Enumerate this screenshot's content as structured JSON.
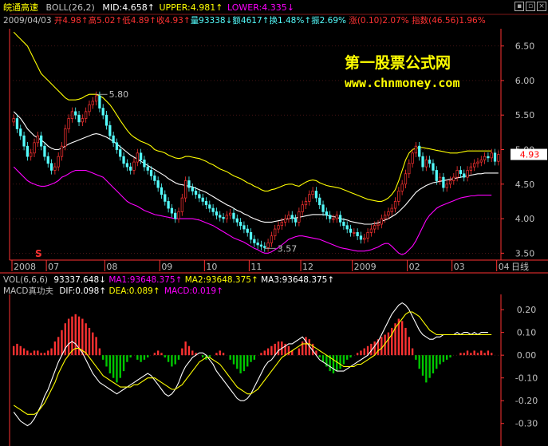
{
  "header": {
    "stock_name": "皖通高速",
    "boll_label": "BOLL(26,2)",
    "mid": "MID:4.658",
    "upper": "UPPER:4.981",
    "lower": "LOWER:4.335",
    "date": "2009/04/03",
    "open": "开4.98",
    "high": "高5.02",
    "low": "低4.89",
    "close": "收4.93",
    "volume": "量93338",
    "amount": "额4617",
    "turnover": "换1.48%",
    "amplitude": "振2.69%",
    "change": "涨(0.10)2.07%",
    "index": "指数(46.56)1.96%"
  },
  "watermark": {
    "title": "第一股票公式网",
    "url": "www.chnmoney.com"
  },
  "vol_bar": {
    "label": "VOL(6,6,6)",
    "value": "93337.648",
    "ma1": "MA1:93648.375",
    "ma2": "MA2:93648.375",
    "ma3": "MA3:93648.375"
  },
  "macd_bar": {
    "label": "MACD真功夫",
    "dif": "DIF:0.098",
    "dea": "DEA:0.089",
    "macd": "MACD:0.019"
  },
  "period_label": "日线",
  "signal_marker": "S",
  "colors": {
    "up": "#ff3232",
    "down": "#54fcfc",
    "upper_band": "#ffff00",
    "mid_band": "#ffffff",
    "lower_band": "#ff00ff",
    "axis": "#ff3232",
    "watermark": "#ffff00",
    "dif": "#ffffff",
    "dea": "#ffff00"
  },
  "chart_data": [
    {
      "type": "candlestick",
      "name": "price",
      "ylim": [
        3.4,
        6.75
      ],
      "y_ticks": [
        "6.50",
        "6.00",
        "5.50",
        "5.00",
        "4.50",
        "4.00",
        "3.50"
      ],
      "y_tick_values": [
        6.5,
        6.0,
        5.5,
        5.0,
        4.5,
        4.0,
        3.5
      ],
      "x_labels": [
        "2008",
        "07",
        "08",
        "09",
        "10",
        "11",
        "12",
        "2009",
        "02",
        "03",
        "04"
      ],
      "x_label_index": [
        0,
        10,
        27,
        43,
        56,
        69,
        84,
        99,
        115,
        128,
        141
      ],
      "annotations": [
        {
          "label": "5.80",
          "index": 24,
          "value": 5.8
        },
        {
          "label": "3.57",
          "index": 73,
          "value": 3.57
        }
      ],
      "last_price": "4.93",
      "last_price_value": 4.93,
      "closes": [
        5.45,
        5.3,
        5.2,
        5.05,
        4.9,
        4.95,
        5.1,
        5.2,
        5.05,
        4.9,
        4.8,
        4.7,
        4.75,
        4.9,
        5.05,
        5.3,
        5.45,
        5.55,
        5.5,
        5.4,
        5.45,
        5.55,
        5.65,
        5.7,
        5.78,
        5.6,
        5.5,
        5.35,
        5.2,
        5.1,
        5.0,
        4.9,
        4.8,
        4.75,
        4.7,
        4.82,
        4.95,
        4.85,
        4.75,
        4.7,
        4.62,
        4.55,
        4.45,
        4.35,
        4.25,
        4.15,
        4.08,
        4.0,
        4.1,
        4.3,
        4.55,
        4.45,
        4.4,
        4.35,
        4.3,
        4.25,
        4.2,
        4.15,
        4.1,
        4.05,
        4.02,
        4.0,
        4.05,
        4.08,
        4.0,
        3.95,
        3.9,
        3.85,
        3.8,
        3.7,
        3.65,
        3.62,
        3.6,
        3.58,
        3.65,
        3.75,
        3.85,
        3.9,
        3.95,
        4.0,
        4.05,
        4.0,
        3.95,
        4.1,
        4.2,
        4.25,
        4.35,
        4.4,
        4.3,
        4.2,
        4.1,
        4.05,
        4.0,
        4.0,
        4.05,
        3.95,
        3.9,
        3.85,
        3.8,
        3.8,
        3.75,
        3.7,
        3.72,
        3.8,
        3.85,
        3.9,
        3.92,
        4.0,
        4.05,
        4.1,
        4.15,
        4.25,
        4.4,
        4.5,
        4.65,
        4.8,
        4.95,
        5.05,
        4.9,
        4.75,
        4.85,
        4.8,
        4.7,
        4.55,
        4.6,
        4.45,
        4.5,
        4.55,
        4.6,
        4.7,
        4.65,
        4.6,
        4.7,
        4.75,
        4.8,
        4.82,
        4.85,
        4.9,
        4.88,
        4.95,
        4.83,
        4.93
      ],
      "upper_band": [
        6.7,
        6.65,
        6.6,
        6.55,
        6.5,
        6.4,
        6.3,
        6.2,
        6.1,
        6.05,
        6.0,
        5.95,
        5.9,
        5.85,
        5.8,
        5.75,
        5.72,
        5.72,
        5.72,
        5.73,
        5.75,
        5.78,
        5.8,
        5.8,
        5.8,
        5.78,
        5.75,
        5.7,
        5.65,
        5.58,
        5.5,
        5.42,
        5.35,
        5.28,
        5.22,
        5.18,
        5.15,
        5.12,
        5.1,
        5.08,
        5.05,
        5.0,
        4.98,
        4.97,
        4.95,
        4.92,
        4.9,
        4.88,
        4.87,
        4.88,
        4.9,
        4.9,
        4.89,
        4.88,
        4.87,
        4.85,
        4.83,
        4.8,
        4.78,
        4.75,
        4.72,
        4.7,
        4.68,
        4.65,
        4.62,
        4.6,
        4.58,
        4.55,
        4.52,
        4.5,
        4.47,
        4.45,
        4.42,
        4.4,
        4.4,
        4.42,
        4.43,
        4.45,
        4.47,
        4.49,
        4.5,
        4.5,
        4.48,
        4.47,
        4.5,
        4.53,
        4.55,
        4.56,
        4.55,
        4.52,
        4.5,
        4.48,
        4.47,
        4.46,
        4.45,
        4.44,
        4.42,
        4.4,
        4.38,
        4.36,
        4.34,
        4.32,
        4.3,
        4.28,
        4.27,
        4.26,
        4.25,
        4.25,
        4.27,
        4.3,
        4.35,
        4.42,
        4.55,
        4.7,
        4.85,
        4.95,
        5.0,
        5.02,
        5.03,
        5.03,
        5.02,
        5.01,
        5.0,
        4.99,
        4.98,
        4.97,
        4.96,
        4.95,
        4.95,
        4.95,
        4.96,
        4.97,
        4.98,
        4.98,
        4.98,
        4.98,
        4.98,
        4.98,
        4.98,
        4.98
      ],
      "mid_band": [
        5.55,
        5.5,
        5.45,
        5.38,
        5.3,
        5.25,
        5.2,
        5.17,
        5.14,
        5.1,
        5.05,
        5.02,
        5.0,
        5.0,
        5.02,
        5.05,
        5.08,
        5.1,
        5.12,
        5.14,
        5.16,
        5.18,
        5.2,
        5.22,
        5.23,
        5.22,
        5.2,
        5.18,
        5.15,
        5.12,
        5.08,
        5.04,
        5.0,
        4.96,
        4.92,
        4.89,
        4.86,
        4.83,
        4.8,
        4.77,
        4.74,
        4.71,
        4.68,
        4.65,
        4.62,
        4.58,
        4.55,
        4.52,
        4.5,
        4.49,
        4.48,
        4.47,
        4.46,
        4.44,
        4.42,
        4.4,
        4.38,
        4.35,
        4.32,
        4.29,
        4.26,
        4.23,
        4.2,
        4.18,
        4.15,
        4.12,
        4.1,
        4.07,
        4.05,
        4.02,
        4.0,
        3.98,
        3.96,
        3.95,
        3.95,
        3.95,
        3.96,
        3.97,
        3.98,
        3.99,
        4.0,
        4.01,
        4.01,
        4.02,
        4.03,
        4.04,
        4.05,
        4.06,
        4.06,
        4.06,
        4.06,
        4.05,
        4.04,
        4.03,
        4.02,
        4.0,
        3.99,
        3.98,
        3.96,
        3.95,
        3.94,
        3.93,
        3.92,
        3.92,
        3.92,
        3.93,
        3.94,
        3.96,
        3.98,
        4.0,
        4.03,
        4.06,
        4.1,
        4.15,
        4.2,
        4.26,
        4.32,
        4.38,
        4.42,
        4.45,
        4.48,
        4.5,
        4.52,
        4.53,
        4.54,
        4.55,
        4.56,
        4.57,
        4.58,
        4.59,
        4.6,
        4.61,
        4.62,
        4.63,
        4.64,
        4.65,
        4.65,
        4.66,
        4.66,
        4.66,
        4.66,
        4.66
      ],
      "lower_band": [
        4.75,
        4.7,
        4.65,
        4.6,
        4.55,
        4.52,
        4.5,
        4.48,
        4.47,
        4.47,
        4.48,
        4.5,
        4.52,
        4.55,
        4.6,
        4.62,
        4.65,
        4.68,
        4.7,
        4.7,
        4.7,
        4.7,
        4.68,
        4.66,
        4.64,
        4.62,
        4.6,
        4.55,
        4.5,
        4.45,
        4.4,
        4.35,
        4.3,
        4.25,
        4.22,
        4.2,
        4.18,
        4.15,
        4.12,
        4.1,
        4.08,
        4.06,
        4.05,
        4.04,
        4.03,
        4.02,
        4.01,
        4.0,
        4.0,
        4.0,
        4.0,
        4.0,
        4.0,
        3.99,
        3.98,
        3.96,
        3.94,
        3.92,
        3.9,
        3.87,
        3.84,
        3.81,
        3.78,
        3.75,
        3.72,
        3.7,
        3.68,
        3.66,
        3.63,
        3.6,
        3.57,
        3.55,
        3.52,
        3.5,
        3.5,
        3.52,
        3.55,
        3.58,
        3.62,
        3.66,
        3.7,
        3.72,
        3.74,
        3.75,
        3.75,
        3.74,
        3.73,
        3.72,
        3.71,
        3.7,
        3.68,
        3.66,
        3.64,
        3.62,
        3.6,
        3.58,
        3.57,
        3.56,
        3.55,
        3.54,
        3.53,
        3.53,
        3.53,
        3.54,
        3.55,
        3.57,
        3.59,
        3.62,
        3.64,
        3.64,
        3.6,
        3.55,
        3.5,
        3.48,
        3.5,
        3.55,
        3.6,
        3.68,
        3.78,
        3.88,
        3.98,
        4.05,
        4.1,
        4.15,
        4.18,
        4.2,
        4.22,
        4.24,
        4.26,
        4.28,
        4.3,
        4.31,
        4.32,
        4.33,
        4.33,
        4.34,
        4.34,
        4.34,
        4.34,
        4.34
      ]
    },
    {
      "type": "macd",
      "name": "MACD真功夫",
      "ylim": [
        -0.35,
        0.26
      ],
      "y_ticks": [
        "0.20",
        "0.10",
        "0.00",
        "-0.10",
        "-0.20",
        "-0.30"
      ],
      "y_tick_values": [
        0.2,
        0.1,
        0.0,
        -0.1,
        -0.2,
        -0.3
      ],
      "macd_hist": [
        0.04,
        0.05,
        0.04,
        0.03,
        0.02,
        0.01,
        0.02,
        0.02,
        0.01,
        0.01,
        0.02,
        0.03,
        0.06,
        0.08,
        0.11,
        0.14,
        0.16,
        0.17,
        0.18,
        0.17,
        0.16,
        0.14,
        0.12,
        0.1,
        0.08,
        0.03,
        -0.02,
        -0.05,
        -0.08,
        -0.1,
        -0.12,
        -0.1,
        -0.07,
        -0.03,
        -0.01,
        0.0,
        -0.02,
        -0.03,
        -0.02,
        -0.01,
        0.0,
        0.01,
        0.02,
        0.01,
        -0.01,
        -0.03,
        -0.05,
        -0.04,
        -0.02,
        0.03,
        0.06,
        0.04,
        0.02,
        0.01,
        0.0,
        -0.01,
        -0.02,
        -0.01,
        0.0,
        0.01,
        0.02,
        0.01,
        0.0,
        -0.02,
        -0.04,
        -0.06,
        -0.08,
        -0.07,
        -0.05,
        -0.03,
        -0.02,
        0.0,
        0.01,
        0.02,
        0.03,
        0.04,
        0.05,
        0.06,
        0.06,
        0.05,
        0.04,
        0.02,
        0.0,
        0.03,
        0.06,
        0.08,
        0.07,
        0.05,
        0.02,
        -0.01,
        -0.03,
        -0.05,
        -0.07,
        -0.08,
        -0.07,
        -0.06,
        -0.04,
        -0.02,
        -0.01,
        0.0,
        0.01,
        0.02,
        0.03,
        0.04,
        0.05,
        0.06,
        0.07,
        0.08,
        0.09,
        0.1,
        0.12,
        0.14,
        0.16,
        0.15,
        0.12,
        0.08,
        0.03,
        -0.02,
        -0.06,
        -0.09,
        -0.12,
        -0.1,
        -0.08,
        -0.06,
        -0.04,
        -0.03,
        -0.02,
        -0.01,
        0.0,
        0.0,
        0.01,
        0.01,
        0.02,
        0.01,
        0.02,
        0.01,
        0.02,
        0.01,
        0.02,
        0.01
      ],
      "dif": [
        -0.25,
        -0.27,
        -0.29,
        -0.3,
        -0.31,
        -0.3,
        -0.28,
        -0.25,
        -0.22,
        -0.18,
        -0.15,
        -0.11,
        -0.07,
        -0.03,
        0.0,
        0.03,
        0.05,
        0.06,
        0.05,
        0.03,
        0.01,
        -0.02,
        -0.05,
        -0.08,
        -0.1,
        -0.12,
        -0.13,
        -0.14,
        -0.15,
        -0.16,
        -0.17,
        -0.16,
        -0.15,
        -0.14,
        -0.13,
        -0.12,
        -0.11,
        -0.1,
        -0.09,
        -0.08,
        -0.09,
        -0.11,
        -0.13,
        -0.15,
        -0.17,
        -0.18,
        -0.17,
        -0.15,
        -0.12,
        -0.08,
        -0.05,
        -0.03,
        -0.01,
        0.0,
        0.01,
        0.01,
        0.0,
        -0.02,
        -0.04,
        -0.07,
        -0.09,
        -0.11,
        -0.13,
        -0.15,
        -0.17,
        -0.19,
        -0.2,
        -0.2,
        -0.19,
        -0.17,
        -0.14,
        -0.11,
        -0.08,
        -0.05,
        -0.03,
        -0.02,
        0.0,
        0.02,
        0.03,
        0.04,
        0.05,
        0.05,
        0.06,
        0.07,
        0.08,
        0.06,
        0.04,
        0.02,
        0.0,
        -0.02,
        -0.03,
        -0.04,
        -0.05,
        -0.06,
        -0.07,
        -0.07,
        -0.07,
        -0.06,
        -0.05,
        -0.04,
        -0.03,
        -0.02,
        -0.01,
        0.0,
        0.02,
        0.04,
        0.06,
        0.09,
        0.12,
        0.15,
        0.18,
        0.2,
        0.22,
        0.23,
        0.22,
        0.2,
        0.17,
        0.14,
        0.11,
        0.09,
        0.08,
        0.07,
        0.07,
        0.08,
        0.08,
        0.09,
        0.09,
        0.09,
        0.09,
        0.1,
        0.09,
        0.1,
        0.1,
        0.09,
        0.1,
        0.09,
        0.1,
        0.1,
        0.1
      ],
      "dea": [
        -0.22,
        -0.23,
        -0.24,
        -0.25,
        -0.26,
        -0.26,
        -0.26,
        -0.25,
        -0.23,
        -0.21,
        -0.18,
        -0.15,
        -0.12,
        -0.08,
        -0.05,
        -0.02,
        0.0,
        0.02,
        0.03,
        0.03,
        0.02,
        0.01,
        -0.01,
        -0.03,
        -0.05,
        -0.07,
        -0.09,
        -0.1,
        -0.11,
        -0.12,
        -0.13,
        -0.14,
        -0.14,
        -0.14,
        -0.14,
        -0.13,
        -0.13,
        -0.12,
        -0.11,
        -0.1,
        -0.1,
        -0.1,
        -0.11,
        -0.12,
        -0.13,
        -0.14,
        -0.15,
        -0.15,
        -0.14,
        -0.13,
        -0.11,
        -0.09,
        -0.07,
        -0.05,
        -0.03,
        -0.02,
        -0.01,
        -0.01,
        -0.02,
        -0.03,
        -0.04,
        -0.06,
        -0.08,
        -0.1,
        -0.12,
        -0.14,
        -0.15,
        -0.16,
        -0.17,
        -0.17,
        -0.16,
        -0.15,
        -0.13,
        -0.11,
        -0.09,
        -0.07,
        -0.05,
        -0.03,
        -0.01,
        0.0,
        0.01,
        0.02,
        0.03,
        0.04,
        0.05,
        0.05,
        0.05,
        0.04,
        0.03,
        0.02,
        0.01,
        0.0,
        -0.01,
        -0.02,
        -0.03,
        -0.04,
        -0.05,
        -0.05,
        -0.05,
        -0.05,
        -0.04,
        -0.04,
        -0.03,
        -0.02,
        -0.01,
        0.0,
        0.02,
        0.03,
        0.05,
        0.07,
        0.09,
        0.12,
        0.14,
        0.16,
        0.18,
        0.19,
        0.19,
        0.18,
        0.17,
        0.15,
        0.13,
        0.11,
        0.1,
        0.09,
        0.09,
        0.09,
        0.09,
        0.09,
        0.09,
        0.09,
        0.09,
        0.09,
        0.09,
        0.09,
        0.09,
        0.09,
        0.09,
        0.09,
        0.09,
        0.09
      ]
    }
  ]
}
